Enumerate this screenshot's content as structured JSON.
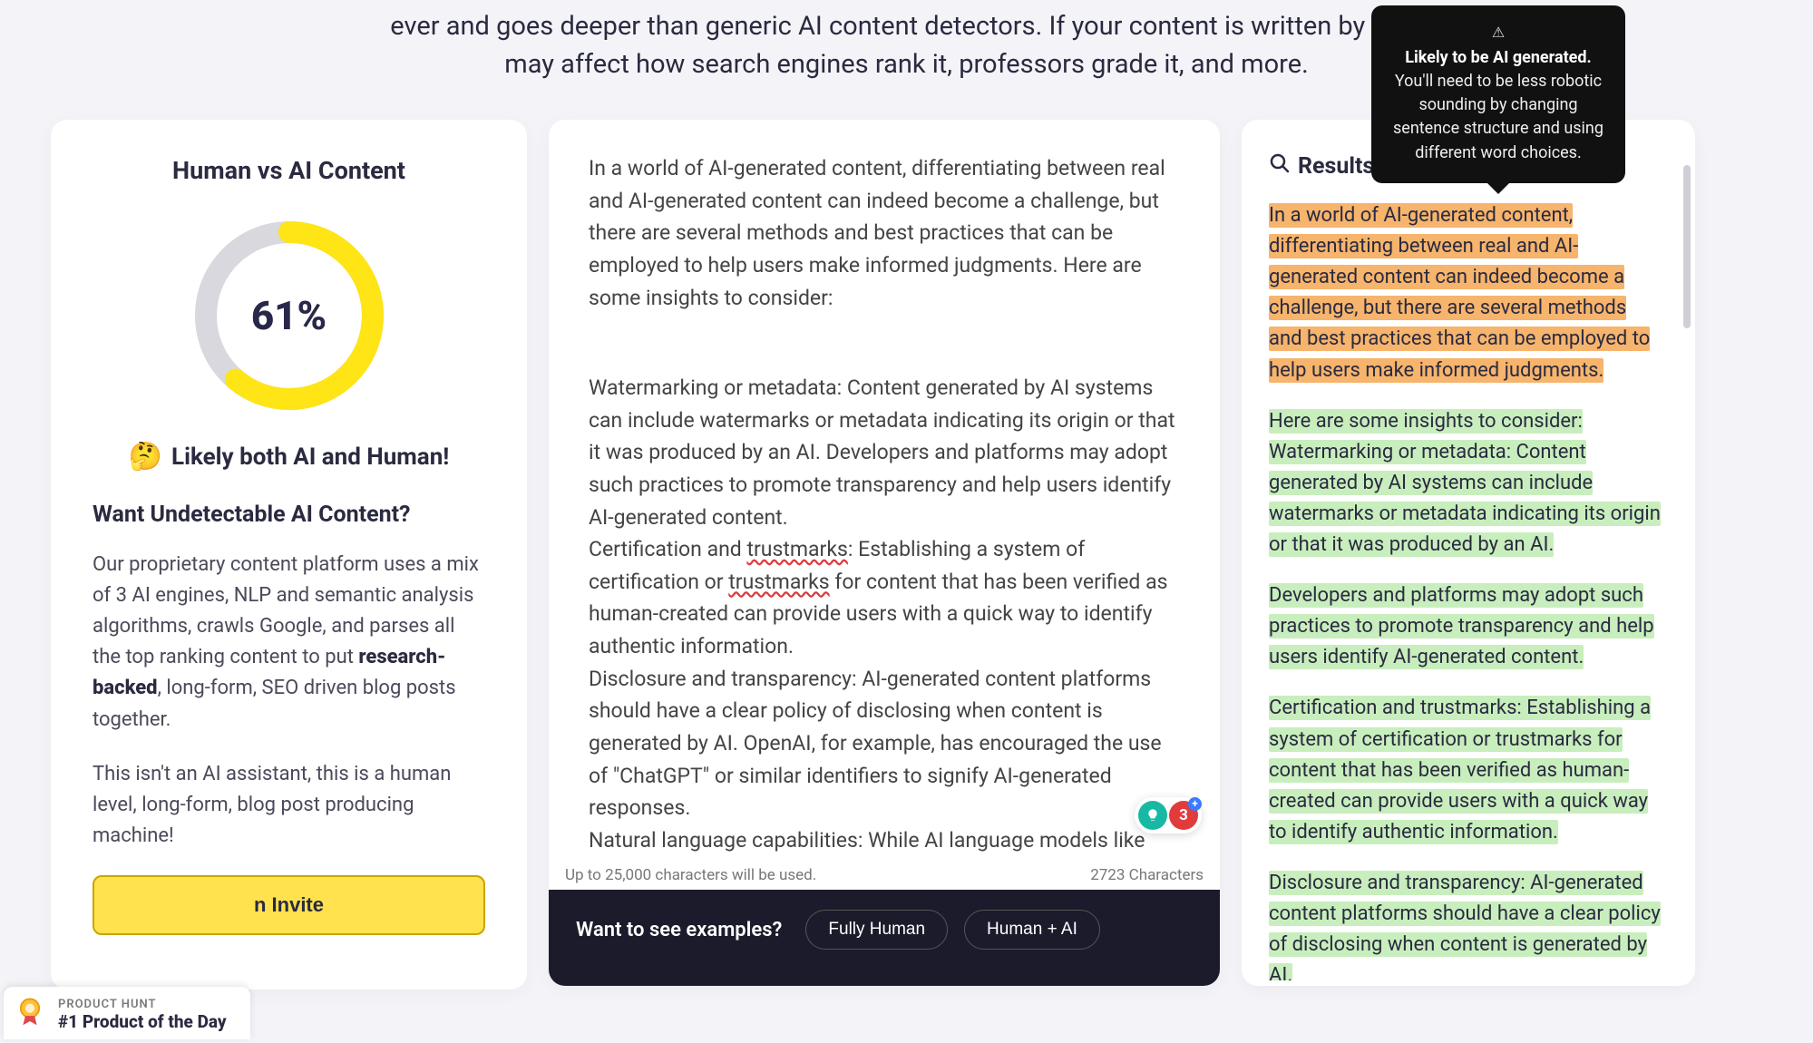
{
  "hero": {
    "line1": "ever and goes deeper than generic AI content detectors. If your content is written by AI, it",
    "line2": "may affect how search engines rank it, professors grade it, and more."
  },
  "left": {
    "heading": "Human vs AI Content",
    "percent_label": "61%",
    "percent_value": 61,
    "verdict_emoji": "🤔",
    "verdict_text": "Likely both AI and Human!",
    "subhead": "Want Undetectable AI Content?",
    "body_p1_a": "Our proprietary content platform uses a mix of 3 AI engines, NLP and semantic analysis algorithms, crawls Google, and parses all the top ranking content to put ",
    "body_p1_strong": "research-backed",
    "body_p1_b": ", long-form, SEO driven blog posts together.",
    "body_p2": "This isn't an AI assistant, this is a human level, long-form, blog post producing machine!",
    "invite_button": "n Invite"
  },
  "mid": {
    "paragraph1": "In a world of AI-generated content, differentiating between real and AI-generated content can indeed become a challenge, but there are several methods and best practices that can be employed to help users make informed judgments. Here are some insights to consider:",
    "para2_a": "Watermarking or metadata: Content generated by AI systems can include watermarks or metadata indicating its origin or that it was produced by an AI. Developers and platforms may adopt such practices to promote transparency and help users identify AI-generated content.\nCertification and ",
    "para2_sp1": "trustmarks",
    "para2_b": ": Establishing a system of certification or ",
    "para2_sp2": "trustmarks",
    "para2_c": " for content that has been verified as human-created can provide users with a quick way to identify authentic information.\nDisclosure and transparency: AI-generated content platforms should have a clear policy of disclosing when content is generated by AI. OpenAI, for example, has encouraged the use of \"ChatGPT\" or similar identifiers to signify AI-generated responses.\nNatural language capabilities: While AI language models like",
    "char_limit_note": "Up to 25,000 characters will be used.",
    "char_count": "2723 Characters",
    "examples_lead": "Want to see examples?",
    "pill_human": "Fully Human",
    "pill_mixed": "Human + AI",
    "float_count": "3"
  },
  "right": {
    "heading": "Results",
    "seg1": "In a world of AI-generated content, differentiating between real and AI-generated content can indeed become a challenge, but there are several methods and best practices that can be employed to help users make informed judgments.",
    "seg2": "Here are some insights to consider: Watermarking or metadata: Content generated by AI systems can include watermarks or metadata indicating its origin or that it was produced by an AI.",
    "seg3": "Developers and platforms may adopt such practices to promote transparency and help users identify AI-generated content.",
    "seg4": "Certification and trustmarks: Establishing a system of certification or trustmarks for content that has been verified as human-created can provide users with a quick way to identify authentic information.",
    "seg5": "Disclosure and transparency: AI-generated content platforms should have a clear policy of disclosing when content is generated by AI."
  },
  "tooltip": {
    "title": "Likely to be AI generated.",
    "body": "You'll need to be less robotic sounding by changing sentence structure and using different word choices."
  },
  "ph": {
    "line1": "PRODUCT HUNT",
    "line2": "#1 Product of the Day"
  }
}
